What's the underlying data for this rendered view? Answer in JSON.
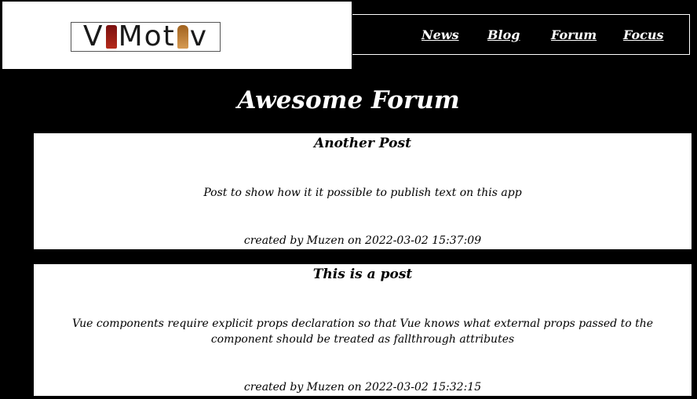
{
  "header": {
    "logo_text": "VI Motiv",
    "nav": [
      {
        "label": "News"
      },
      {
        "label": "Blog"
      },
      {
        "label": "Forum"
      },
      {
        "label": "Focus"
      }
    ]
  },
  "page": {
    "title": "Awesome Forum"
  },
  "posts": [
    {
      "title": "Another Post",
      "body": "Post to show how it it possible to publish text on this app",
      "meta": "created by Muzen on 2022-03-02 15:37:09"
    },
    {
      "title": "This is a post",
      "body": "Vue components require explicit props declaration so that Vue knows what external props passed to the component should be treated as fallthrough attributes",
      "meta": "created by Muzen on 2022-03-02 15:32:15"
    }
  ],
  "colors": {
    "background": "#000000",
    "card": "#ffffff",
    "text_on_dark": "#ffffff"
  }
}
